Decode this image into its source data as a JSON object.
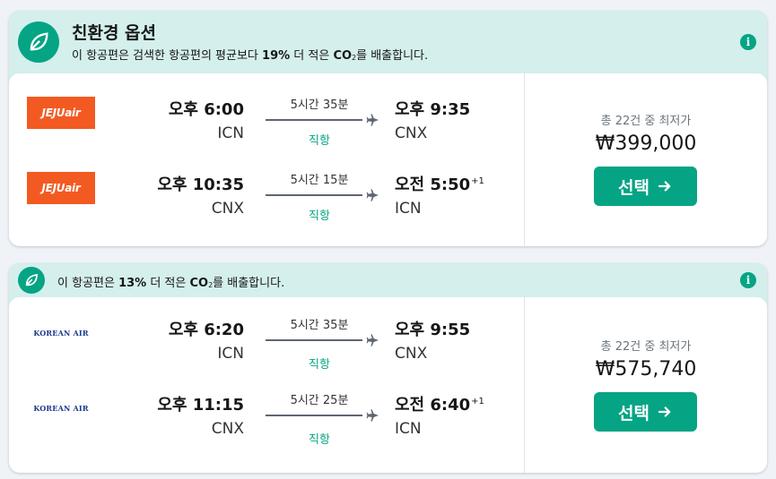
{
  "colors": {
    "accent": "#05a484",
    "eco_bg": "#d4efec",
    "jeju_brand": "#f25a22",
    "korean_brand": "#1a3a8c"
  },
  "cards": [
    {
      "eco": {
        "title": "친환경 옵션",
        "desc_pre": "이 항공편은 검색한 항공편의 평균보다 ",
        "desc_pct": "19%",
        "desc_mid": " 더 적은 ",
        "desc_co": "CO",
        "desc_sub": "2",
        "desc_post": "를 배출합니다.",
        "icon": "leaf-icon",
        "info_icon": "info-icon",
        "info_glyph": "i"
      },
      "legs": [
        {
          "airline_logo_text": "JEJUair",
          "dep_time": "오후 6:00",
          "dep_code": "ICN",
          "duration": "5시간 35분",
          "stops": "직항",
          "arr_time": "오후 9:35",
          "arr_plus": "",
          "arr_code": "CNX"
        },
        {
          "airline_logo_text": "JEJUair",
          "dep_time": "오후 10:35",
          "dep_code": "CNX",
          "duration": "5시간 15분",
          "stops": "직항",
          "arr_time": "오전 5:50",
          "arr_plus": "+1",
          "arr_code": "ICN"
        }
      ],
      "price": {
        "sub": "총 22건 중 최저가",
        "amount": "₩399,000",
        "button": "선택",
        "button_icon": "arrow-right-icon"
      }
    },
    {
      "eco": {
        "title": "",
        "desc_pre": "이 항공편은 ",
        "desc_pct": "13%",
        "desc_mid": " 더 적은 ",
        "desc_co": "CO",
        "desc_sub": "2",
        "desc_post": "를 배출합니다.",
        "icon": "leaf-icon",
        "info_icon": "info-icon",
        "info_glyph": "i"
      },
      "legs": [
        {
          "airline_logo_text": "KOREAN AIR",
          "dep_time": "오후 6:20",
          "dep_code": "ICN",
          "duration": "5시간 35분",
          "stops": "직항",
          "arr_time": "오후 9:55",
          "arr_plus": "",
          "arr_code": "CNX"
        },
        {
          "airline_logo_text": "KOREAN AIR",
          "dep_time": "오후 11:15",
          "dep_code": "CNX",
          "duration": "5시간 25분",
          "stops": "직항",
          "arr_time": "오전 6:40",
          "arr_plus": "+1",
          "arr_code": "ICN"
        }
      ],
      "price": {
        "sub": "총 22건 중 최저가",
        "amount": "₩575,740",
        "button": "선택",
        "button_icon": "arrow-right-icon"
      }
    }
  ]
}
